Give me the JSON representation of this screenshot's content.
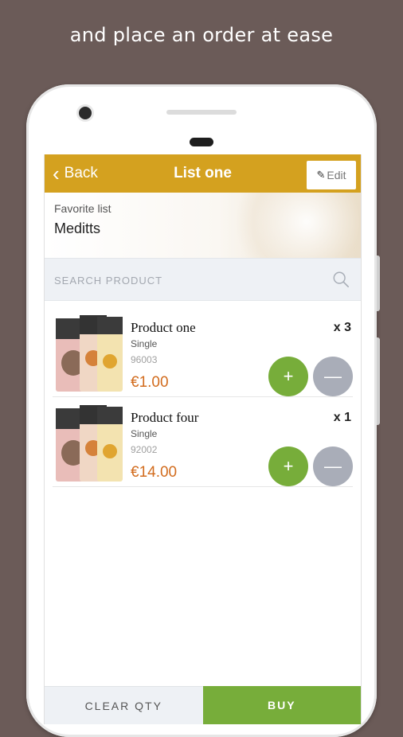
{
  "caption": "and place an order at ease",
  "header": {
    "back_label": "Back",
    "title": "List one",
    "edit_label": "Edit"
  },
  "list": {
    "label": "Favorite list",
    "name": "Meditts"
  },
  "search": {
    "placeholder": "SEARCH PRODUCT"
  },
  "items": [
    {
      "name": "Product one",
      "type": "Single",
      "code": "96003",
      "price": "€1.00",
      "qty": "x 3"
    },
    {
      "name": "Product four",
      "type": "Single",
      "code": "92002",
      "price": "€14.00",
      "qty": "x 1"
    }
  ],
  "footer": {
    "clear_label": "CLEAR QTY",
    "buy_label": "BUY"
  },
  "colors": {
    "brand_gold": "#d4a11f",
    "accent_green": "#77ad3a",
    "price_orange": "#d26c1e",
    "minus_gray": "#a9adb8",
    "background": "#6b5b58"
  }
}
